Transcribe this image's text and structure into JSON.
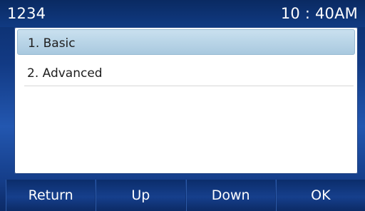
{
  "status_bar": {
    "account": "1234",
    "time": "10 : 40AM"
  },
  "menu": {
    "items": [
      {
        "label": "1. Basic",
        "selected": true
      },
      {
        "label": "2. Advanced",
        "selected": false
      }
    ]
  },
  "softkeys": [
    {
      "label": "Return"
    },
    {
      "label": "Up"
    },
    {
      "label": "Down"
    },
    {
      "label": "OK"
    }
  ],
  "colors": {
    "bar_blue": "#103a82",
    "selection": "#b7d4e8",
    "panel": "#ffffff"
  }
}
